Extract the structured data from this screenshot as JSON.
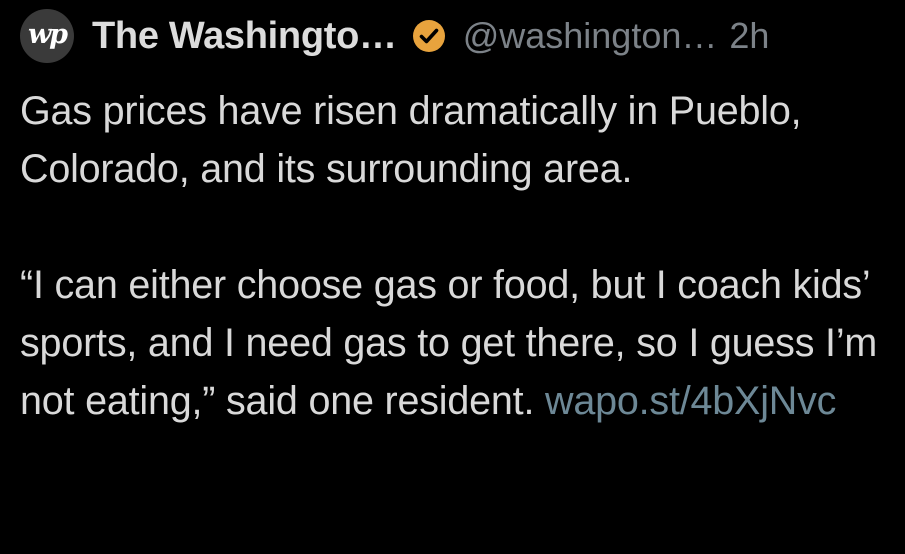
{
  "tweet": {
    "avatar_text": "wp",
    "display_name": "The Washingto…",
    "handle": "@washington…",
    "dot": "",
    "time": "2h",
    "paragraph1": "Gas prices have risen dramatically in Pueblo, Colorado, and its surrounding area.",
    "paragraph2": "“I can either choose gas or food, but I coach kids’ sports, and I need gas to get there, so I guess I’m not eating,” said one resident.",
    "link": "wapo.st/4bXjNvc"
  },
  "colors": {
    "background": "#000000",
    "text": "#d9d9d9",
    "muted": "#7c8288",
    "link": "#6d8896",
    "verified_badge": "#e8a33d"
  },
  "icons": {
    "verified": "verified-check-icon",
    "avatar": "washington-post-logo"
  }
}
